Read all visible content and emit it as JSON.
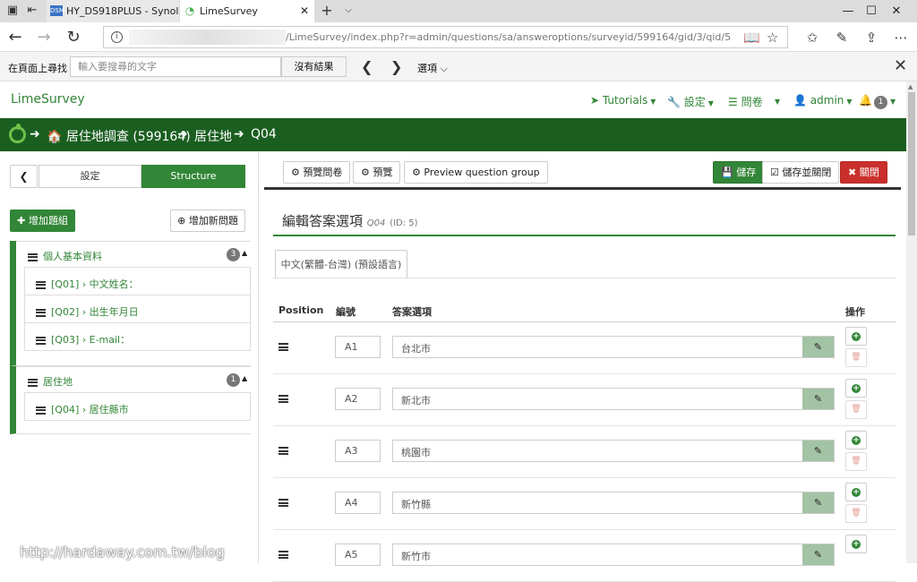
{
  "browser": {
    "tabs": [
      {
        "label": "HY_DS918PLUS - Synology D",
        "favicon": "DSM"
      },
      {
        "label": "LimeSurvey"
      }
    ],
    "new_tab": "+",
    "url": "/LimeSurvey/index.php?r=admin/questions/sa/answeroptions/surveyid/599164/gid/3/qid/5",
    "find": {
      "label": "在頁面上尋找",
      "placeholder": "輸入要搜尋的文字",
      "result": "沒有結果",
      "options": "選項"
    }
  },
  "topnav": {
    "brand": "LimeSurvey",
    "items": [
      "Tutorials",
      "設定",
      "問卷",
      "admin"
    ],
    "notifications": "1"
  },
  "breadcrumb": {
    "survey": "居住地調查 (599164)",
    "group": "居住地",
    "question": "Q04"
  },
  "sidebar": {
    "tab_settings": "設定",
    "tab_structure": "Structure",
    "add_group": "增加題組",
    "add_question": "增加新問題",
    "groups": [
      {
        "name": "個人基本資料",
        "count": "3",
        "questions": [
          "[Q01] › 中文姓名：",
          "[Q02] › 出生年月日",
          "[Q03] › E-mail："
        ]
      },
      {
        "name": "居住地",
        "count": "1",
        "questions": [
          "[Q04] › 居住縣市"
        ]
      }
    ]
  },
  "toolbar": {
    "preview_survey": "預覽問卷",
    "preview": "預覽",
    "preview_group": "Preview question group",
    "save": "儲存",
    "save_close": "儲存並關閉",
    "close": "關閉"
  },
  "editor": {
    "title": "編輯答案選項",
    "qcode": "Q04",
    "qid": "(ID: 5)",
    "language_tab": "中文(繁體-台灣) (預設語言)",
    "columns": {
      "position": "Position",
      "code": "編號",
      "answer": "答案選項",
      "actions": "操作"
    },
    "rows": [
      {
        "code": "A1",
        "answer": "台北市"
      },
      {
        "code": "A2",
        "answer": "新北市"
      },
      {
        "code": "A3",
        "answer": "桃園市"
      },
      {
        "code": "A4",
        "answer": "新竹縣"
      },
      {
        "code": "A5",
        "answer": "新竹市"
      }
    ]
  },
  "watermark": "http://hardaway.com.tw/blog"
}
